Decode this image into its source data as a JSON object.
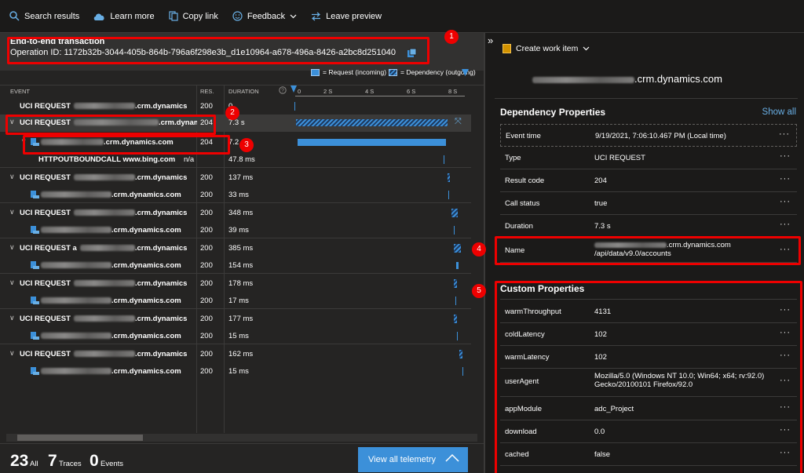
{
  "toolbar": {
    "search_results": "Search results",
    "learn_more": "Learn more",
    "copy_link": "Copy link",
    "feedback": "Feedback",
    "leave_preview": "Leave preview"
  },
  "transaction": {
    "title": "End-to-end transaction",
    "operation_id": "Operation ID: 1172b32b-3044-405b-864b-796a6f298e3b_d1e10964-a678-496a-8426-a2bc8d251040"
  },
  "legend": {
    "request": "= Request (incoming)",
    "dependency": "= Dependency (outgoing)"
  },
  "columns": {
    "event": "EVENT",
    "res": "RES.",
    "duration": "DURATION"
  },
  "timescale": [
    "0",
    "2 S",
    "4 S",
    "6 S",
    "8 S"
  ],
  "rows": [
    {
      "event_prefix": "UCI REQUEST",
      "event_suffix": ".crm.dynamics",
      "res": "200",
      "duration": "0"
    },
    {
      "event_prefix": "UCI REQUEST",
      "event_suffix": ".crm.dynamics",
      "res": "204",
      "duration": "7.3 s"
    },
    {
      "event_prefix": "",
      "event_suffix": ".crm.dynamics.com",
      "res": "204",
      "duration": "7.2"
    },
    {
      "event_prefix": "HTTPOUTBOUNDCALL www.bing.com",
      "event_suffix": "",
      "res": "n/a",
      "duration": "47.8 ms"
    },
    {
      "event_prefix": "UCI REQUEST",
      "event_suffix": ".crm.dynamics",
      "res": "200",
      "duration": "137 ms"
    },
    {
      "event_prefix": "",
      "event_suffix": ".crm.dynamics.com",
      "res": "200",
      "duration": "33 ms"
    },
    {
      "event_prefix": "UCI REQUEST",
      "event_suffix": ".crm.dynamics",
      "res": "200",
      "duration": "348 ms"
    },
    {
      "event_prefix": "",
      "event_suffix": ".crm.dynamics.com",
      "res": "200",
      "duration": "39 ms"
    },
    {
      "event_prefix": "UCI REQUEST a",
      "event_suffix": ".crm.dynamics",
      "res": "200",
      "duration": "385 ms"
    },
    {
      "event_prefix": "",
      "event_suffix": ".crm.dynamics.com",
      "res": "200",
      "duration": "154 ms"
    },
    {
      "event_prefix": "UCI REQUEST",
      "event_suffix": ".crm.dynamics",
      "res": "200",
      "duration": "178 ms"
    },
    {
      "event_prefix": "",
      "event_suffix": ".crm.dynamics.com",
      "res": "200",
      "duration": "17 ms"
    },
    {
      "event_prefix": "UCI REQUEST",
      "event_suffix": ".crm.dynamics",
      "res": "200",
      "duration": "177 ms"
    },
    {
      "event_prefix": "",
      "event_suffix": ".crm.dynamics.com",
      "res": "200",
      "duration": "15 ms"
    },
    {
      "event_prefix": "UCI REQUEST",
      "event_suffix": ".crm.dynamics",
      "res": "200",
      "duration": "162 ms"
    },
    {
      "event_prefix": "",
      "event_suffix": ".crm.dynamics.com",
      "res": "200",
      "duration": "15 ms"
    }
  ],
  "footer": {
    "all_count": "23",
    "all_label": "All",
    "traces_count": "7",
    "traces_label": "Traces",
    "events_count": "0",
    "events_label": "Events",
    "view_all": "View all telemetry"
  },
  "callouts": [
    "1",
    "2",
    "3",
    "4",
    "5"
  ],
  "details": {
    "create_work_item": "Create work item",
    "title_suffix": ".crm.dynamics.com",
    "dependency_properties_title": "Dependency Properties",
    "show_all": "Show all",
    "dependency_properties": [
      {
        "key": "Event time",
        "value": "9/19/2021, 7:06:10.467 PM (Local time)"
      },
      {
        "key": "Type",
        "value": "UCI REQUEST"
      },
      {
        "key": "Result code",
        "value": "204"
      },
      {
        "key": "Call status",
        "value": "true"
      },
      {
        "key": "Duration",
        "value": "7.3 s"
      },
      {
        "key": "Name",
        "value_line1": ".crm.dynamics.com",
        "value_line2": "/api/data/v9.0/accounts"
      }
    ],
    "custom_properties_title": "Custom Properties",
    "custom_properties": [
      {
        "key": "warmThroughput",
        "value": "4131"
      },
      {
        "key": "coldLatency",
        "value": "102"
      },
      {
        "key": "warmLatency",
        "value": "102"
      },
      {
        "key": "userAgent",
        "value_line1": "Mozilla/5.0 (Windows NT 10.0; Win64; x64; rv:92.0)",
        "value_line2": "Gecko/20100101 Firefox/92.0"
      },
      {
        "key": "appModule",
        "value": "adc_Project"
      },
      {
        "key": "download",
        "value": "0.0"
      },
      {
        "key": "cached",
        "value": "false"
      }
    ],
    "more_label": "···"
  },
  "colors": {
    "accent": "#3c90d9",
    "callout": "#e00000",
    "link": "#69afe5"
  }
}
